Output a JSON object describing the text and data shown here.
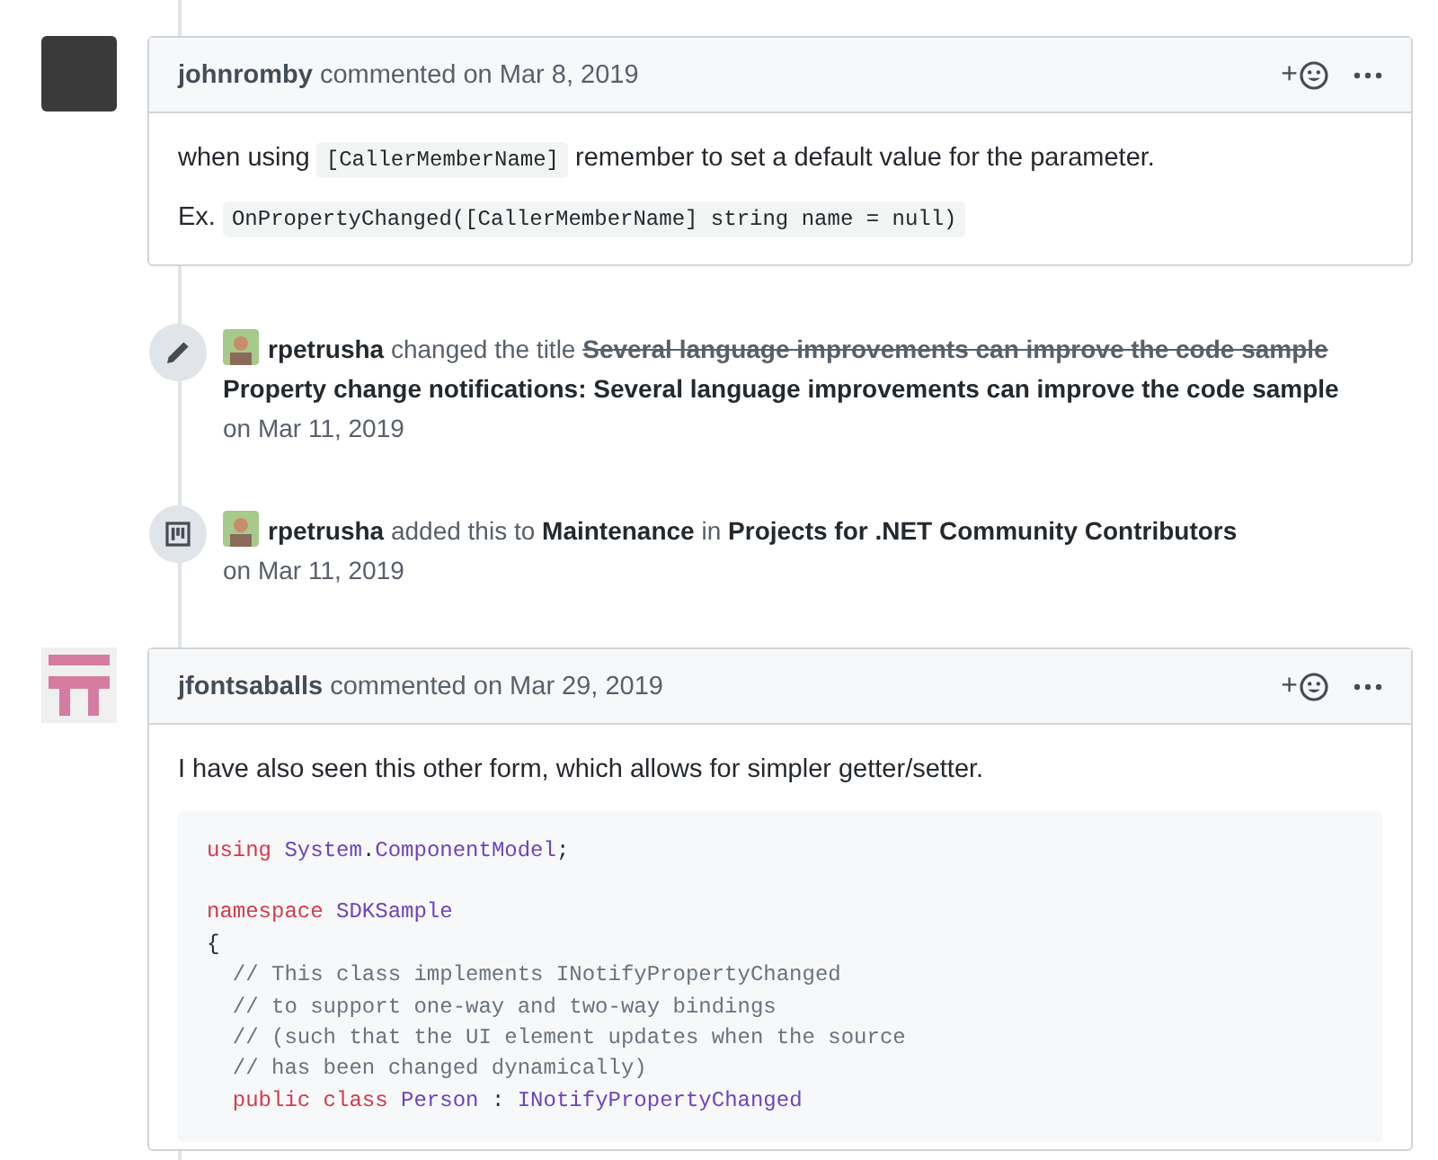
{
  "timeline": [
    {
      "kind": "comment",
      "author": "johnromby",
      "action": "commented on Mar 8, 2019",
      "reaction_label": "+",
      "body": [
        {
          "kind": "paragraph",
          "segments": [
            {
              "kind": "text",
              "text": "when using "
            },
            {
              "kind": "code",
              "text": "[CallerMemberName]"
            },
            {
              "kind": "text",
              "text": " remember to set a default value for the parameter."
            }
          ]
        },
        {
          "kind": "paragraph",
          "segments": [
            {
              "kind": "text",
              "text": "Ex. "
            },
            {
              "kind": "code",
              "text": "OnPropertyChanged([CallerMemberName] string name = null)"
            }
          ]
        }
      ]
    },
    {
      "kind": "renamed",
      "actor": "rpetrusha",
      "parts": [
        {
          "kind": "plain",
          "text": "changed the title"
        },
        {
          "kind": "strike",
          "text": "Several language improvements can improve the code sample"
        },
        {
          "kind": "bold",
          "text": "Property change notifications: Several language improvements can improve the code sample"
        }
      ],
      "date": "on Mar 11, 2019"
    },
    {
      "kind": "project_added",
      "actor": "rpetrusha",
      "parts": [
        {
          "kind": "plain",
          "text": "added this to"
        },
        {
          "kind": "bold",
          "text": "Maintenance"
        },
        {
          "kind": "plain",
          "text": "in"
        },
        {
          "kind": "bold",
          "text": "Projects for .NET Community Contributors"
        }
      ],
      "date": "on Mar 11, 2019"
    },
    {
      "kind": "comment",
      "author": "jfontsaballs",
      "action": "commented on Mar 29, 2019",
      "reaction_label": "+",
      "body": [
        {
          "kind": "paragraph",
          "segments": [
            {
              "kind": "text",
              "text": "I have also seen this other form, which allows for simpler getter/setter."
            }
          ]
        },
        {
          "kind": "code_block",
          "groups": [
            {
              "lines": [
                [
                  {
                    "kind": "keyword",
                    "text": "using"
                  },
                  {
                    "kind": "type",
                    "text": " System"
                  },
                  {
                    "kind": "plain",
                    "text": "."
                  },
                  {
                    "kind": "type",
                    "text": "ComponentModel"
                  },
                  {
                    "kind": "plain",
                    "text": ";"
                  }
                ]
              ]
            },
            {
              "lines": [
                [
                  {
                    "kind": "keyword",
                    "text": "namespace"
                  },
                  {
                    "kind": "type",
                    "text": " SDKSample"
                  }
                ],
                [
                  {
                    "kind": "plain",
                    "text": "{"
                  }
                ],
                [
                  {
                    "kind": "comment",
                    "text": "  // This class implements INotifyPropertyChanged"
                  }
                ],
                [
                  {
                    "kind": "comment",
                    "text": "  // to support one-way and two-way bindings"
                  }
                ],
                [
                  {
                    "kind": "comment",
                    "text": "  // (such that the UI element updates when the source"
                  }
                ],
                [
                  {
                    "kind": "comment",
                    "text": "  // has been changed dynamically)"
                  }
                ],
                [
                  {
                    "kind": "keyword",
                    "text": "  public"
                  },
                  {
                    "kind": "keyword",
                    "text": " class"
                  },
                  {
                    "kind": "type",
                    "text": " Person"
                  },
                  {
                    "kind": "plain",
                    "text": " : "
                  },
                  {
                    "kind": "type",
                    "text": "INotifyPropertyChanged"
                  }
                ]
              ]
            }
          ]
        }
      ]
    }
  ]
}
